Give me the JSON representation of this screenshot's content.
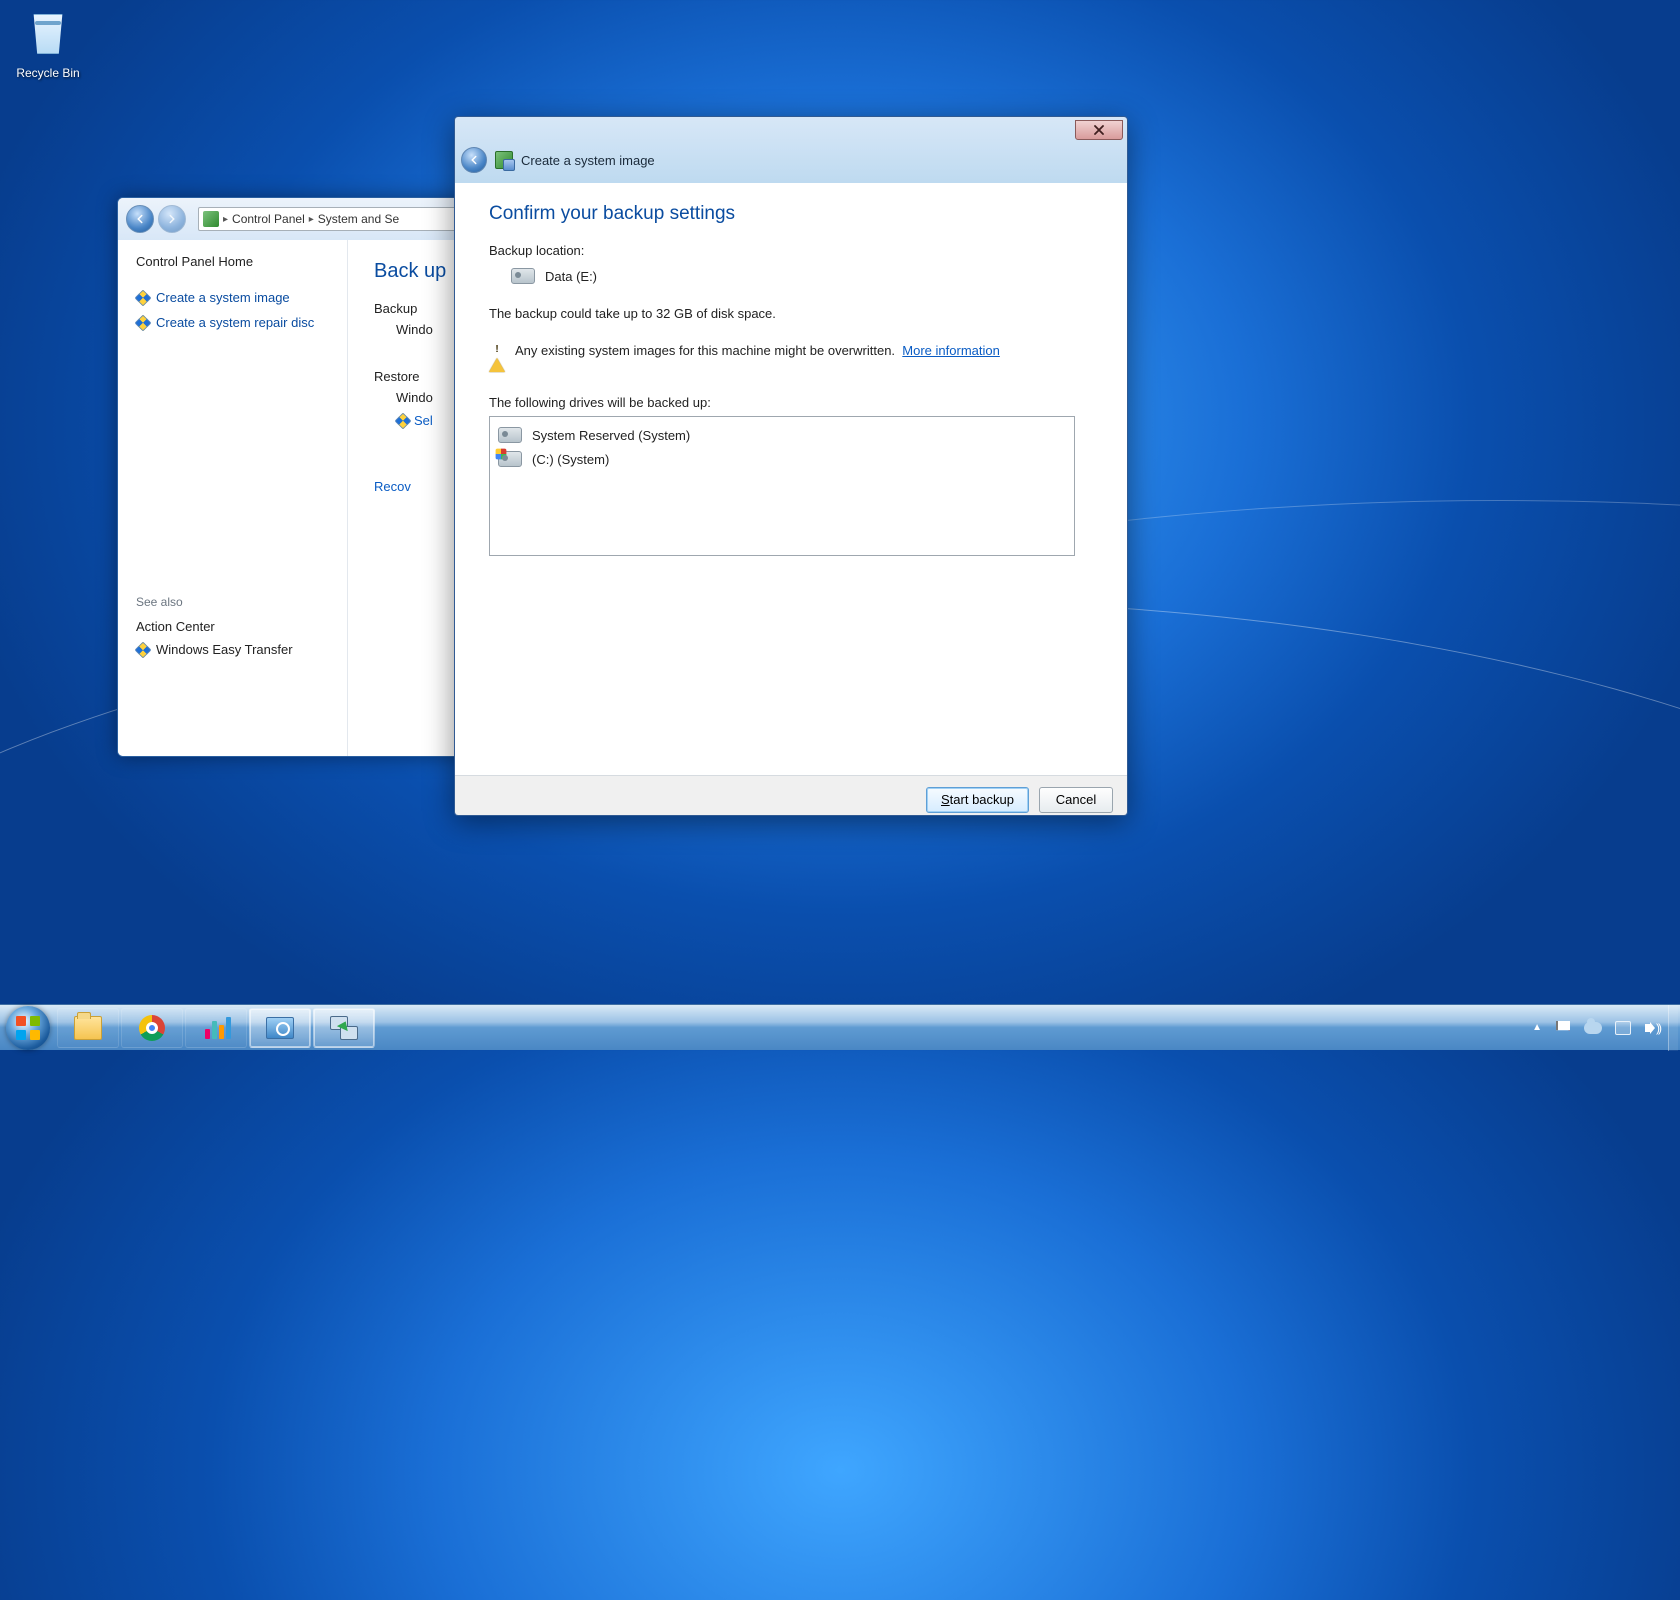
{
  "desktop": {
    "recycle_bin": "Recycle Bin"
  },
  "control_panel": {
    "breadcrumb": [
      "Control Panel",
      "System and Se"
    ],
    "sidebar": {
      "home": "Control Panel Home",
      "links": [
        "Create a system image",
        "Create a system repair disc"
      ],
      "see_also_heading": "See also",
      "see_also": [
        "Action Center",
        "Windows Easy Transfer"
      ]
    },
    "main": {
      "heading_prefix": "Back up",
      "backup_heading": "Backup",
      "backup_line": "Windo",
      "restore_heading": "Restore",
      "restore_line1": "Windo",
      "restore_link": "Sel",
      "recover_link": "Recov"
    }
  },
  "wizard": {
    "title": "Create a system image",
    "heading": "Confirm your backup settings",
    "backup_location_label": "Backup location:",
    "backup_location_value": "Data (E:)",
    "size_note": "The backup could take up to 32 GB of disk space.",
    "warning_text": "Any existing system images for this machine might be overwritten.",
    "more_info": "More information",
    "drives_label": "The following drives will be backed up:",
    "drives": [
      "System Reserved (System)",
      "(C:) (System)"
    ],
    "buttons": {
      "start": "Start backup",
      "cancel": "Cancel"
    }
  },
  "taskbar": {
    "items": [
      "start",
      "explorer",
      "chrome",
      "bars",
      "control-panel",
      "easy-transfer"
    ]
  }
}
